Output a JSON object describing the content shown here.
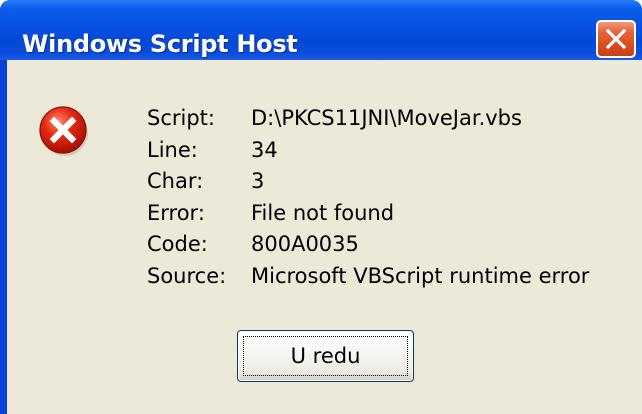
{
  "window": {
    "title": "Windows Script Host"
  },
  "icons": {
    "close": "close-icon",
    "error": "error-icon"
  },
  "message": {
    "rows": [
      {
        "label": "Script:",
        "value": "D:\\PKCS11JNI\\MoveJar.vbs"
      },
      {
        "label": "Line:",
        "value": "34"
      },
      {
        "label": "Char:",
        "value": "3"
      },
      {
        "label": "Error:",
        "value": "File not found"
      },
      {
        "label": "Code:",
        "value": "800A0035"
      },
      {
        "label": "Source:",
        "value": "Microsoft VBScript runtime error"
      }
    ]
  },
  "buttons": {
    "ok_label": "U redu"
  },
  "colors": {
    "titlebar": "#0852e2",
    "client_background": "#ece9d8",
    "close_button": "#d94a20",
    "error_icon": "#d11a08"
  }
}
